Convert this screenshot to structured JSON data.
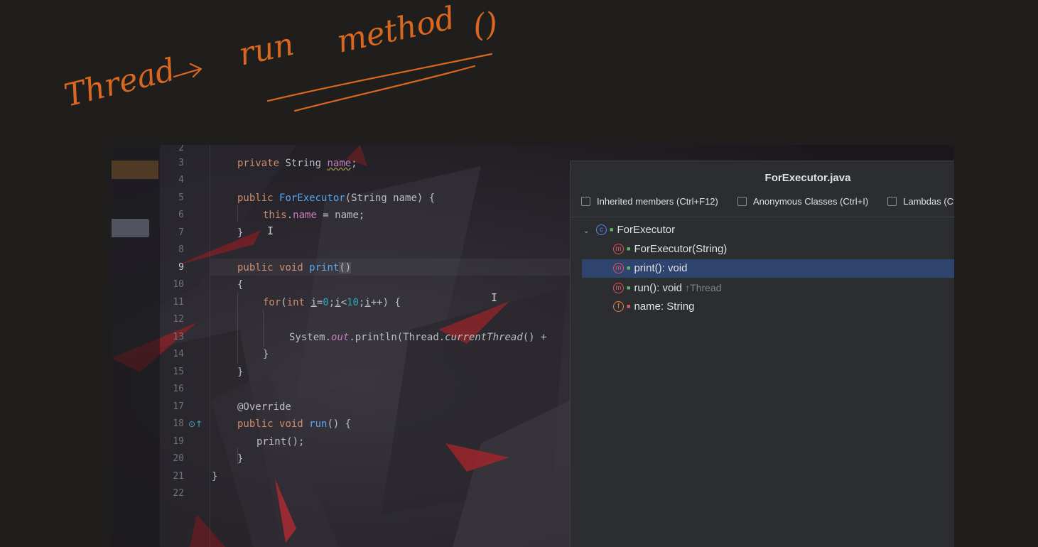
{
  "annotation": {
    "word_thread": "Thread",
    "word_run": "run",
    "word_method": "method",
    "word_parens": "()"
  },
  "editor": {
    "line_numbers": [
      "2",
      "3",
      "4",
      "5",
      "6",
      "7",
      "8",
      "9",
      "10",
      "11",
      "12",
      "13",
      "14",
      "15",
      "16",
      "17",
      "18",
      "19",
      "20",
      "21",
      "22"
    ],
    "active_line": "9",
    "code": {
      "l3": {
        "private": "private",
        "type": "String ",
        "name": "name",
        "semi": ";"
      },
      "l5": {
        "public": "public ",
        "ctor": "ForExecutor",
        "params": "(String name) {"
      },
      "l6": {
        "this": "this",
        "dot": ".",
        "name": "name",
        "rest": " = name;"
      },
      "l7": "}",
      "l9": {
        "public": "public ",
        "void": "void ",
        "method": "print",
        "parens": "()"
      },
      "l10": "{",
      "l11": {
        "for": "for",
        "p1": "(",
        "int": "int ",
        "i1": "i",
        "eq": "=",
        "zero": "0",
        "semi1": ";",
        "i2": "i",
        "lt": "<",
        "ten": "10",
        "semi2": ";",
        "i3": "i",
        "rest": "++) {"
      },
      "l13": {
        "sys": "System.",
        "out": "out",
        "println": ".println(Thread.",
        "ct": "currentThread",
        "rest": "() +"
      },
      "l14": "}",
      "l15": "}",
      "l17": "@Override",
      "l18": {
        "public": "public ",
        "void": "void ",
        "method": "run",
        "rest": "() {"
      },
      "l19": "print();",
      "l20": "}",
      "l21": "}"
    }
  },
  "structure": {
    "title": "ForExecutor.java",
    "filters": [
      {
        "label": "Inherited members (Ctrl+F12)",
        "checked": false
      },
      {
        "label": "Anonymous Classes (Ctrl+I)",
        "checked": false
      },
      {
        "label": "Lambdas (Ct",
        "checked": false
      }
    ],
    "tree": {
      "class_name": "ForExecutor",
      "members": [
        {
          "label": "ForExecutor(String)",
          "kind": "m"
        },
        {
          "label": "print(): void",
          "kind": "m",
          "selected": true
        },
        {
          "label": "run(): void",
          "kind": "m",
          "hint": "↑Thread"
        },
        {
          "label": "name: String",
          "kind": "f"
        }
      ]
    }
  }
}
